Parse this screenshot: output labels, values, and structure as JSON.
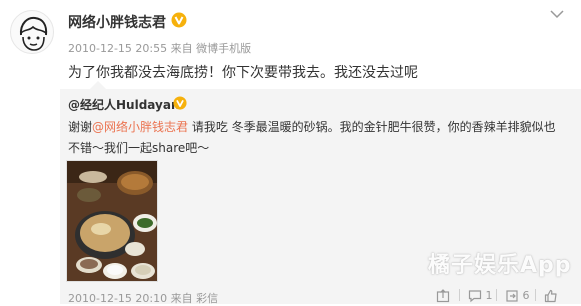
{
  "post": {
    "author": "网络小胖钱志君",
    "timestamp": "2010-12-15 20:55",
    "source_prefix": "来自",
    "source": "微博手机版",
    "text": "为了你我都没去海底捞！你下次要带我去。我还没去过呢"
  },
  "repost": {
    "author": "@经纪人Huldayan",
    "text_prefix": "谢谢",
    "mention": "@网络小胖钱志君",
    "text_body": " 请我吃  冬季最温暖的砂锅。我的金针肥牛很赞，你的香辣羊排貌似也不错～我们一起share吧～",
    "timestamp": "2010-12-15 20:10",
    "source_prefix": "来自",
    "source": "彩信",
    "actions": {
      "comment_count": "1",
      "repost_count": "6"
    }
  },
  "watermark": "橘子娱乐App",
  "colors": {
    "mention": "#eb7350",
    "verified_badge": "#f6b10c",
    "repost_bg": "#f4f4f4"
  },
  "icons": [
    "avatar",
    "verified-badge-icon",
    "chevron-down-icon",
    "share-icon",
    "comment-icon",
    "repost-icon",
    "like-icon"
  ]
}
